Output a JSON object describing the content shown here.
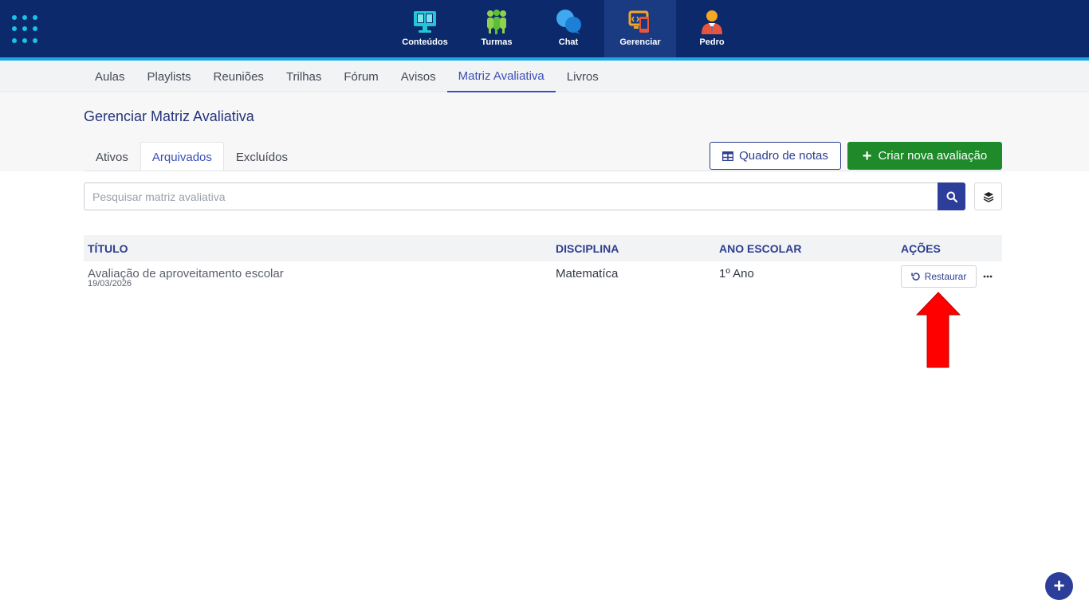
{
  "topnav": {
    "items": [
      {
        "label": "Conteúdos",
        "icon": "monitor-book-icon",
        "active": false
      },
      {
        "label": "Turmas",
        "icon": "people-group-icon",
        "active": false
      },
      {
        "label": "Chat",
        "icon": "chat-bubbles-icon",
        "active": false
      },
      {
        "label": "Gerenciar",
        "icon": "manage-devices-icon",
        "active": true
      },
      {
        "label": "Pedro",
        "icon": "user-avatar-icon",
        "active": false
      }
    ]
  },
  "subnav": {
    "items": [
      "Aulas",
      "Playlists",
      "Reuniões",
      "Trilhas",
      "Fórum",
      "Avisos",
      "Matriz Avaliativa",
      "Livros"
    ],
    "active": "Matriz Avaliativa"
  },
  "page": {
    "title": "Gerenciar Matriz Avaliativa",
    "tabs": [
      "Ativos",
      "Arquivados",
      "Excluídos"
    ],
    "active_tab": "Arquivados",
    "grade_button": "Quadro de notas",
    "create_button": "Criar nova avaliação"
  },
  "search": {
    "placeholder": "Pesquisar matriz avaliativa",
    "value": ""
  },
  "table": {
    "headers": [
      "TÍTULO",
      "DISCIPLINA",
      "ANO ESCOLAR",
      "AÇÕES"
    ],
    "rows": [
      {
        "title": "Avaliação de aproveitamento escolar",
        "date": "19/03/2026",
        "subject": "Matematíca",
        "year": "1º Ano",
        "action": "Restaurar"
      }
    ]
  },
  "colors": {
    "topbar": "#0c2a6b",
    "accent": "#1aa7e8",
    "primary": "#2c3e8f",
    "success": "#1e8a2a",
    "arrow": "#ff0000"
  }
}
